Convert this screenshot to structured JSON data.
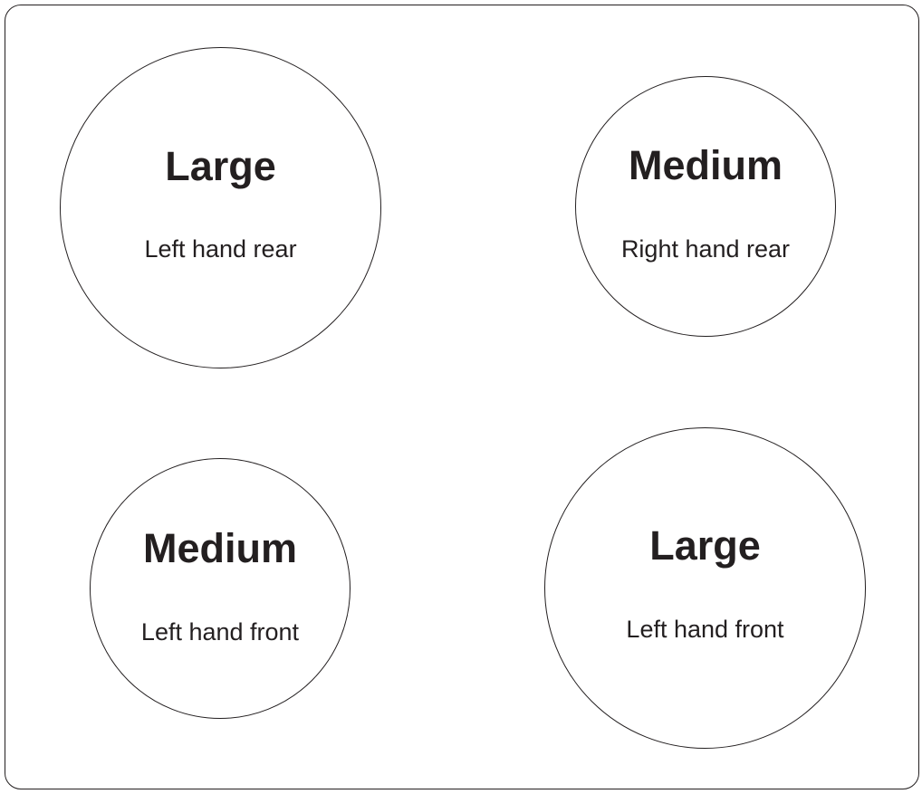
{
  "zones": [
    {
      "id": "left-hand-rear",
      "size": "Large",
      "position": "Left hand rear"
    },
    {
      "id": "right-hand-rear",
      "size": "Medium",
      "position": "Right hand rear"
    },
    {
      "id": "left-hand-front",
      "size": "Medium",
      "position": "Left hand front"
    },
    {
      "id": "right-hand-front",
      "size": "Large",
      "position": "Left hand front"
    }
  ],
  "colors": {
    "stroke": "#231f20",
    "text": "#231f20",
    "background": "#ffffff"
  }
}
